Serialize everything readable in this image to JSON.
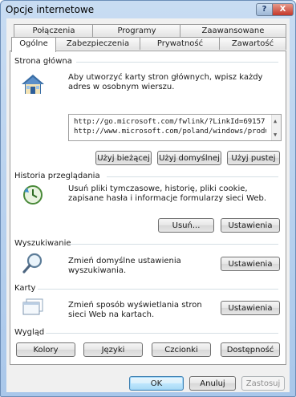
{
  "window": {
    "title": "Opcje internetowe",
    "help_glyph": "?",
    "close_glyph": "X"
  },
  "tabs": {
    "row_top": [
      "Połączenia",
      "Programy",
      "Zaawansowane"
    ],
    "row_bottom": [
      "Ogólne",
      "Zabezpieczenia",
      "Prywatność",
      "Zawartość"
    ],
    "active": "Ogólne"
  },
  "home": {
    "title": "Strona główna",
    "description": "Aby utworzyć karty stron głównych, wpisz każdy adres w osobnym wierszu.",
    "urls": [
      "http://go.microsoft.com/fwlink/?LinkId=69157",
      "http://www.microsoft.com/poland/windows/product"
    ],
    "buttons": [
      "Użyj bieżącej",
      "Użyj domyślnej",
      "Użyj pustej"
    ]
  },
  "history": {
    "title": "Historia przeglądania",
    "description": "Usuń pliki tymczasowe, historię, pliki cookie, zapisane hasła i informacje formularzy sieci Web.",
    "delete_button": "Usuń...",
    "settings_button": "Ustawienia"
  },
  "search": {
    "title": "Wyszukiwanie",
    "description": "Zmień domyślne ustawienia wyszukiwania.",
    "settings_button": "Ustawienia"
  },
  "tabs_section": {
    "title": "Karty",
    "description": "Zmień sposób wyświetlania stron sieci Web na kartach.",
    "settings_button": "Ustawienia"
  },
  "appearance": {
    "title": "Wygląd",
    "buttons": [
      "Kolory",
      "Języki",
      "Czcionki",
      "Dostępność"
    ]
  },
  "footer": {
    "ok": "OK",
    "cancel": "Anuluj",
    "apply": "Zastosuj"
  },
  "colors": {
    "titlebar": "#b9d1ee",
    "close": "#c4382a",
    "panel_bg": "#ffffff",
    "client_bg": "#f0f0f0"
  },
  "icons": [
    "home-icon",
    "history-icon",
    "search-magnifier-icon",
    "tabs-icon"
  ]
}
